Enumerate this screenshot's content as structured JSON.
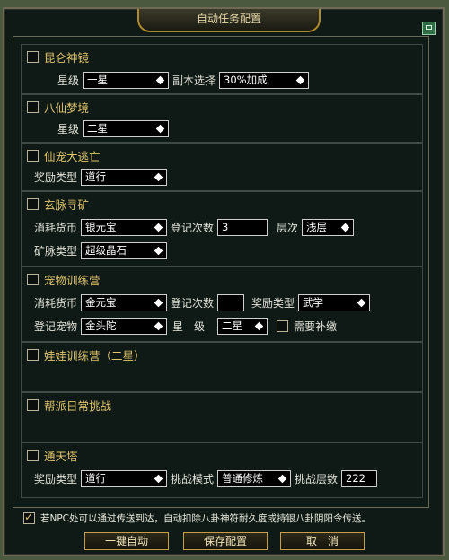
{
  "window": {
    "title": "自动任务配置"
  },
  "sections": {
    "kunlun": {
      "title": "昆仑神镜",
      "star_label": "星级",
      "star_value": "一星",
      "dungeon_label": "副本选择",
      "dungeon_value": "30%加成"
    },
    "baxian": {
      "title": "八仙梦境",
      "star_label": "星级",
      "star_value": "二星"
    },
    "xianzong": {
      "title": "仙宠大逃亡",
      "reward_label": "奖励类型",
      "reward_value": "道行"
    },
    "xuanmai": {
      "title": "玄脉寻矿",
      "currency_label": "消耗货币",
      "currency_value": "银元宝",
      "count_label": "登记次数",
      "count_value": "3",
      "layer_label": "层次",
      "layer_value": "浅层",
      "ore_label": "矿脉类型",
      "ore_value": "超级晶石"
    },
    "pet": {
      "title": "宠物训练营",
      "currency_label": "消耗货币",
      "currency_value": "金元宝",
      "count_label": "登记次数",
      "count_value": "",
      "reward_label": "奖励类型",
      "reward_value": "武学",
      "pet_label": "登记宠物",
      "pet_value": "金头陀",
      "star_label": "星　级",
      "star_value": "二星",
      "need_label": "需要补缴"
    },
    "doll": {
      "title": "娃娃训练营（二星）"
    },
    "gang": {
      "title": "帮派日常挑战"
    },
    "tower": {
      "title": "通天塔",
      "reward_label": "奖励类型",
      "reward_value": "道行",
      "mode_label": "挑战模式",
      "mode_value": "普通修炼",
      "floors_label": "挑战层数",
      "floors_value": "222"
    }
  },
  "footer": {
    "note": "若NPC处可以通过传送到达，自动扣除八卦神符耐久度或持银八卦阴阳令传送。",
    "btn_auto": "一键自动",
    "btn_save": "保存配置",
    "btn_cancel": "取　消"
  },
  "colors": {
    "title_gold": "#e0c46a",
    "panel_bg": "#0f1a17",
    "border_gold": "#c6a045"
  }
}
